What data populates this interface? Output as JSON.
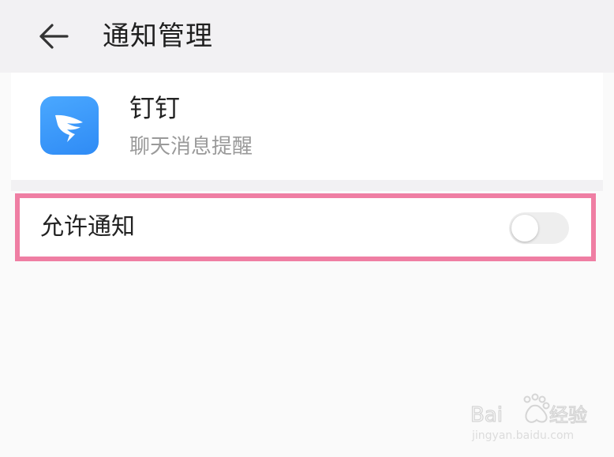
{
  "header": {
    "title": "通知管理",
    "back_icon": "arrow-left-icon"
  },
  "app": {
    "name": "钉钉",
    "subtitle": "聊天消息提醒",
    "icon": "dingtalk-app-icon",
    "icon_color": "#3a97fa"
  },
  "settings": {
    "allow_notifications_label": "允许通知",
    "allow_notifications_enabled": false
  },
  "annotation": {
    "highlight_color": "#ef7ea3"
  },
  "watermark": {
    "brand": "Bai 经验",
    "url": "jingyan.baidu.com"
  }
}
